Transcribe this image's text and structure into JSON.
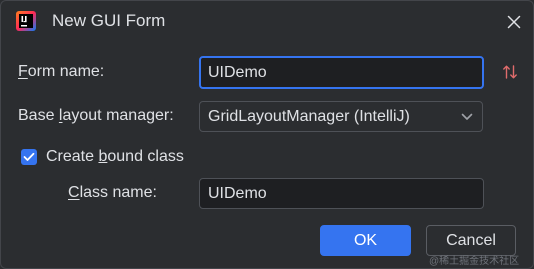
{
  "window": {
    "title": "New GUI Form",
    "app_icon": "intellij-idea-icon",
    "close_icon": "close-icon"
  },
  "form": {
    "form_name_label": "Form name:",
    "form_name_value": "UIDemo",
    "sort_icon": "sort-arrows-icon",
    "layout_label": "Base layout manager:",
    "layout_value": "GridLayoutManager (IntelliJ)",
    "create_bound_class_label": "Create bound class",
    "create_bound_class_checked": true,
    "class_name_label": "Class name:",
    "class_name_value": "UIDemo"
  },
  "buttons": {
    "ok_label": "OK",
    "cancel_label": "Cancel"
  },
  "watermark": "@稀土掘金技术社区",
  "colors": {
    "background": "#2b2d30",
    "accent": "#3574f0",
    "text": "#dfe1e5",
    "field_background": "#1e1f22",
    "sort_icon": "#e06c6c"
  }
}
